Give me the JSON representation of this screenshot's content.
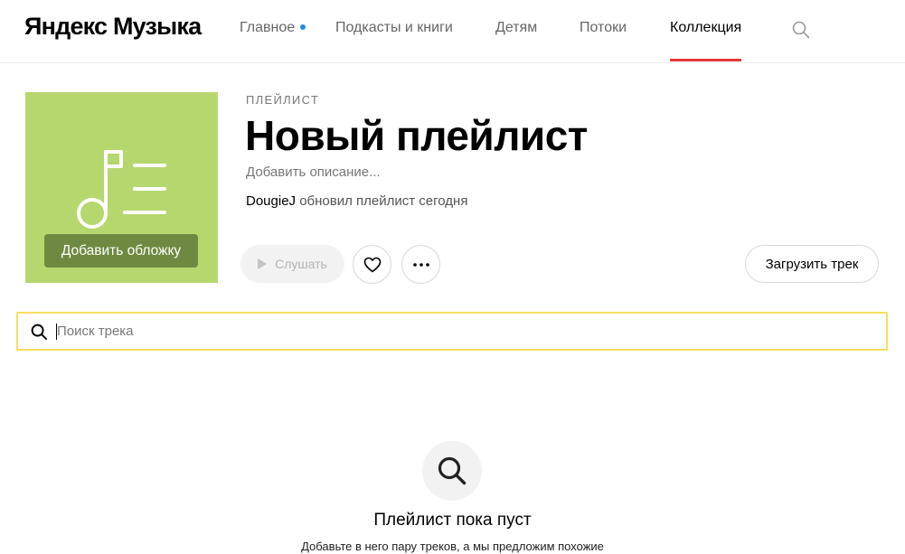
{
  "header": {
    "logo": "Яндекс Музыка",
    "nav": [
      {
        "label": "Главное",
        "has_dot": true
      },
      {
        "label": "Подкасты и книги"
      },
      {
        "label": "Детям"
      },
      {
        "label": "Потоки"
      },
      {
        "label": "Коллекция",
        "active": true
      }
    ],
    "search_icon": "search-icon",
    "accent_color": "#e53935",
    "dot_color": "#1e88e5"
  },
  "cover": {
    "background": "#b6d76e",
    "icon": "music-note-list-icon",
    "add_cover_label": "Добавить обложку"
  },
  "playlist": {
    "type_label": "ПЛЕЙЛИСТ",
    "title": "Новый плейлист",
    "description_placeholder": "Добавить описание...",
    "owner": "DougieJ",
    "updated_text": "обновил плейлист сегодня"
  },
  "actions": {
    "listen_label": "Слушать",
    "like_icon": "heart-icon",
    "more_icon": "more-dots-icon",
    "upload_label": "Загрузить трек"
  },
  "track_search": {
    "placeholder": "Поиск трека",
    "value": "",
    "border_color": "#f7dd63"
  },
  "empty_state": {
    "icon": "search-icon",
    "title": "Плейлист пока пуст",
    "subtitle": "Добавьте в него пару треков, а мы предложим похожие"
  }
}
